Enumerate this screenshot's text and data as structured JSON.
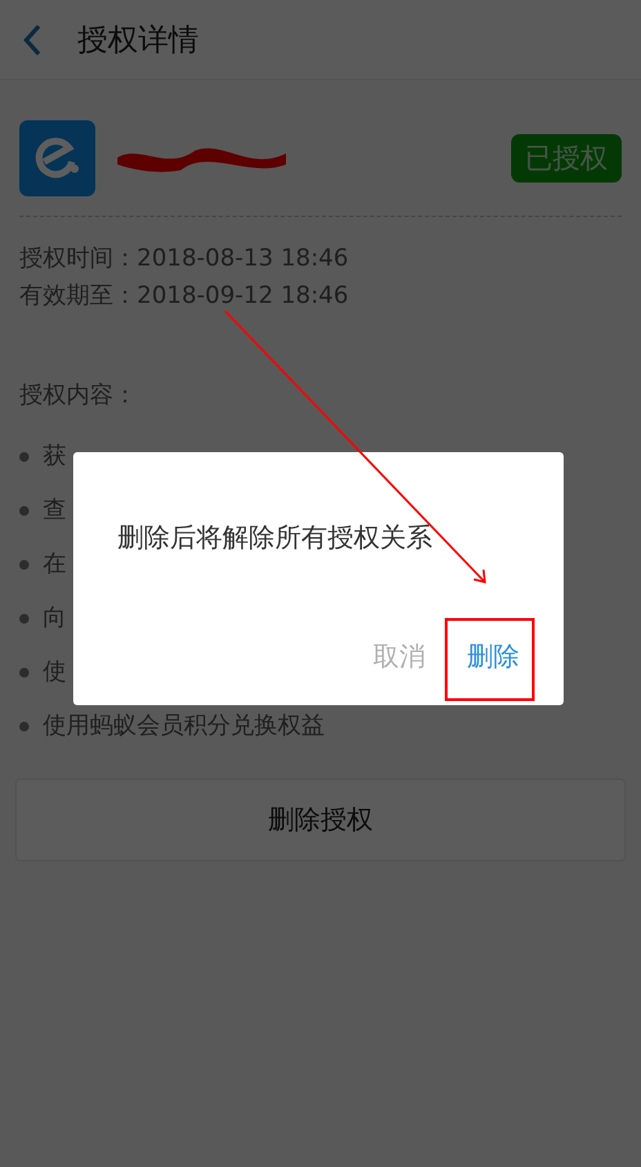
{
  "header": {
    "title": "授权详情"
  },
  "app": {
    "status": "已授权"
  },
  "times": [
    "授权时间：2018-08-13 18:46",
    "有效期至：2018-09-12 18:46"
  ],
  "scope": {
    "heading": "授权内容：",
    "items": [
      "获",
      "查",
      "在",
      "向",
      "使",
      "使用蚂蚁会员积分兑换权益"
    ]
  },
  "revoke_button": "删除授权",
  "dialog": {
    "message": "删除后将解除所有授权关系",
    "buttons": [
      {
        "label": "取消",
        "kind": "cancel"
      },
      {
        "label": "删除",
        "kind": "confirm"
      }
    ]
  }
}
